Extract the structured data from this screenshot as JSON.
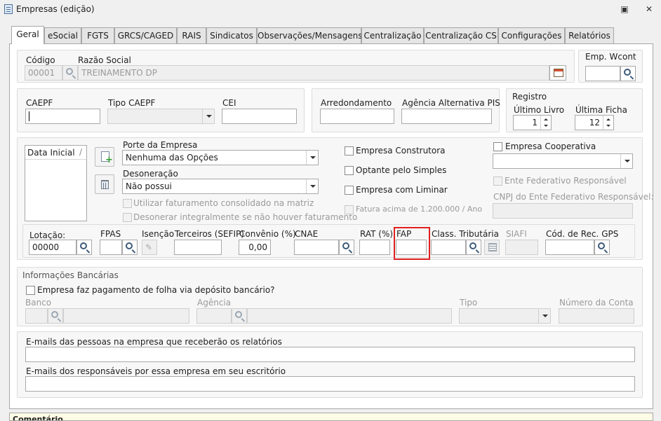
{
  "window": {
    "title": "Empresas (edição)"
  },
  "tabs": [
    "Geral",
    "eSocial",
    "FGTS",
    "GRCS/CAGED",
    "RAIS",
    "Sindicatos",
    "Observações/Mensagens",
    "Centralização",
    "Centralização CS",
    "Configurações",
    "Relatórios"
  ],
  "ident": {
    "codigo_label": "Código",
    "codigo_value": "00001",
    "razao_label": "Razão Social",
    "razao_value": "TREINAMENTO DP",
    "wcont_label": "Emp. Wcont",
    "wcont_value": ""
  },
  "caepf": {
    "caepf_label": "CAEPF",
    "tipo_label": "Tipo CAEPF",
    "cei_label": "CEI",
    "arred_label": "Arredondamento",
    "agencia_pis_label": "Agência Alternativa PIS"
  },
  "registro": {
    "title": "Registro",
    "ultimo_livro_label": "Último Livro",
    "ultimo_livro_value": "1",
    "ultima_ficha_label": "Última Ficha",
    "ultima_ficha_value": "12"
  },
  "porte": {
    "list_header": "Data Inicial",
    "porte_label": "Porte da Empresa",
    "porte_value": "Nenhuma das Opções",
    "deson_label": "Desoneração",
    "deson_value": "Não possui",
    "cb_fat_consol": "Utilizar faturamento consolidado na matriz",
    "cb_deson_integral": "Desonerar integralmente se não houver faturamento"
  },
  "flags": {
    "construtora": "Empresa Construtora",
    "simples": "Optante pelo Simples",
    "liminar": "Empresa com Liminar",
    "fatura": "Fatura acima de 1.200.000 / Ano",
    "cooperativa": "Empresa Cooperativa",
    "ente": "Ente Federativo Responsável",
    "cnpj_ente": "CNPJ do Ente Federativo Responsável:"
  },
  "tributos": {
    "lotacao_label": "Lotação:",
    "lotacao_value": "00000",
    "fpas_label": "FPAS",
    "isencao_label": "Isenção",
    "terceiros_label": "Terceiros (SEFIP)",
    "convenio_label": "Convênio (%)",
    "convenio_value": "0,00",
    "cnae_label": "CNAE",
    "rat_label": "RAT (%)",
    "fap_label": "FAP",
    "class_label": "Class. Tributária",
    "siafi_label": "SIAFI",
    "gps_label": "Cód. de Rec. GPS"
  },
  "banco": {
    "title": "Informações Bancárias",
    "cb_label": "Empresa faz pagamento de folha via depósito bancário?",
    "banco_label": "Banco",
    "agencia_label": "Agência",
    "tipo_label": "Tipo",
    "conta_label": "Número da Conta"
  },
  "emails": {
    "rel_label": "E-mails das pessoas na empresa que receberão os relatórios",
    "resp_label": "E-mails dos responsáveis por essa empresa em seu escritório"
  },
  "comment": {
    "label": "Comentário"
  },
  "colors": {
    "highlight": "#e02020"
  }
}
